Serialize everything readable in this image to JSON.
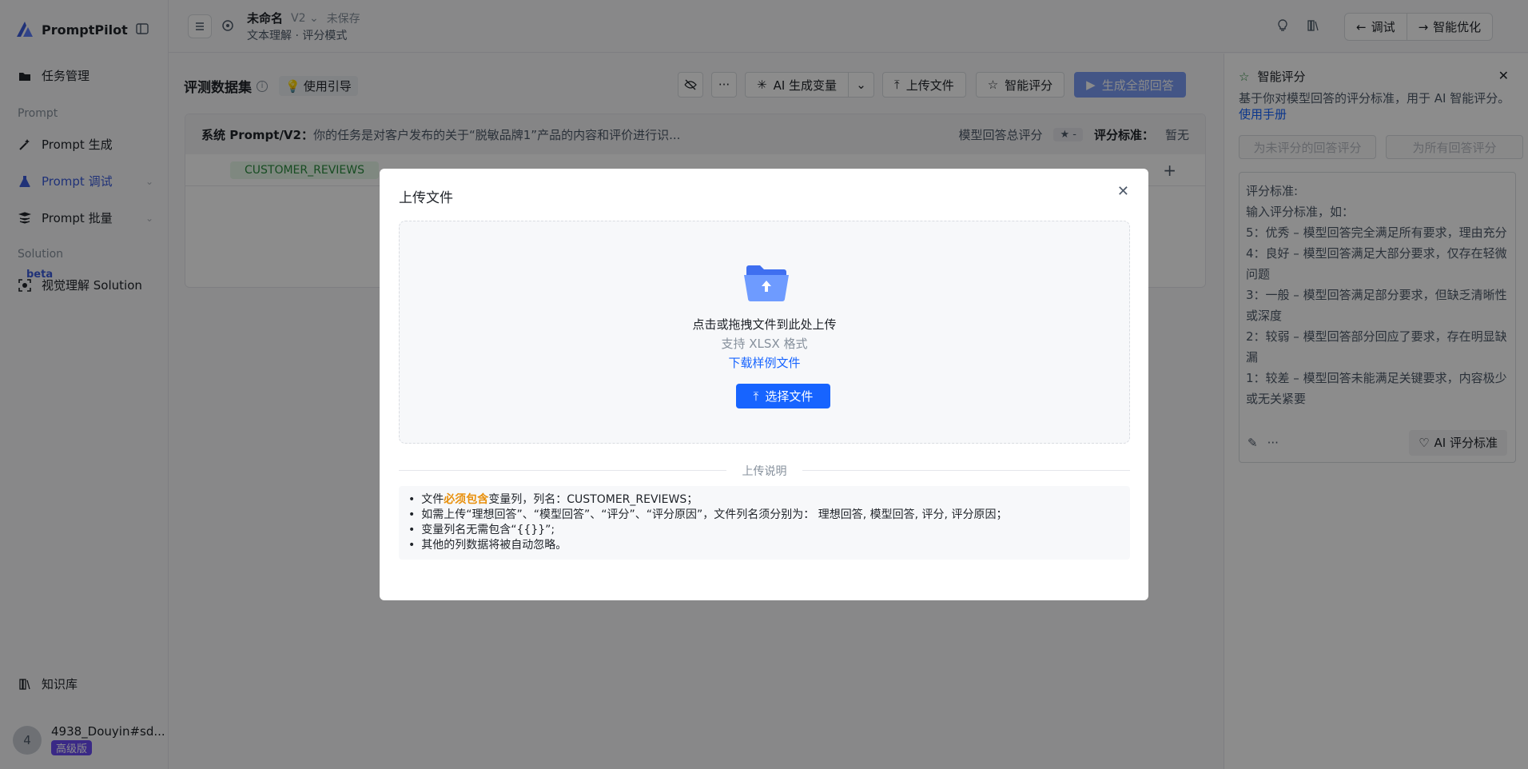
{
  "app": {
    "name": "PromptPilot"
  },
  "sidebar": {
    "items": [
      {
        "label": "任务管理"
      },
      {
        "label": "Prompt 生成"
      },
      {
        "label": "Prompt 调试"
      },
      {
        "label": "Prompt 批量"
      },
      {
        "label": "视觉理解 Solution"
      },
      {
        "label": "知识库"
      }
    ],
    "section_prompt": "Prompt",
    "section_solution": "Solution",
    "beta": "beta",
    "user": {
      "avatar": "4",
      "name": "4938_Douyin#sd...",
      "plan": "高级版"
    }
  },
  "header": {
    "title": "未命名",
    "version": "V2",
    "status": "未保存",
    "subtitle": "文本理解 · 评分模式",
    "debug": "调试",
    "optimize": "智能优化"
  },
  "main": {
    "title": "评测数据集",
    "guide": "使用引导",
    "toolbar": {
      "ai_gen": "AI 生成变量",
      "upload": "上传文件",
      "smart_score": "智能评分",
      "gen_all": "生成全部回答"
    },
    "prompt_label": "系统 Prompt/V2：",
    "prompt_text": "你的任务是对客户发布的关于“脱敏品牌1”产品的内容和评价进行识...",
    "total_label": "模型回答总评分",
    "star_value": "-",
    "std_label": "评分标准：",
    "std_value": "暂无",
    "column_var": "CUSTOMER_REVIEWS"
  },
  "right_panel": {
    "title": "智能评分",
    "desc": "基于你对模型回答的评分标准，用于 AI 智能评分。",
    "manual": "使用手册",
    "btn_unscored": "为未评分的回答评分",
    "btn_all": "为所有回答评分",
    "criteria": [
      "评分标准:",
      "输入评分标准，如：",
      "5：优秀 – 模型回答完全满足所有要求，理由充分",
      "4：良好 – 模型回答满足大部分要求，仅存在轻微问题",
      "3：一般 – 模型回答满足部分要求，但缺乏清晰性或深度",
      "2：较弱 – 模型回答部分回应了要求，存在明显缺漏",
      "1：较差 – 模型回答未能满足关键要求，内容极少或无关紧要"
    ],
    "ai_std": "AI 评分标准"
  },
  "modal": {
    "title": "上传文件",
    "drop_main": "点击或拖拽文件到此处上传",
    "drop_sub": "支持 XLSX 格式",
    "download_sample": "下载样例文件",
    "choose": "选择文件",
    "notes_title": "上传说明",
    "notes": {
      "n1_prefix": "文件",
      "n1_highlight": "必须包含",
      "n1_suffix": "变量列，列名：CUSTOMER_REVIEWS；",
      "n2": "如需上传“理想回答”、“模型回答”、“评分”、“评分原因”，文件列名须分别为： 理想回答, 模型回答, 评分, 评分原因；",
      "n3": "变量列名无需包含“{{}}”;",
      "n4": "其他的列数据将被自动忽略。"
    }
  }
}
